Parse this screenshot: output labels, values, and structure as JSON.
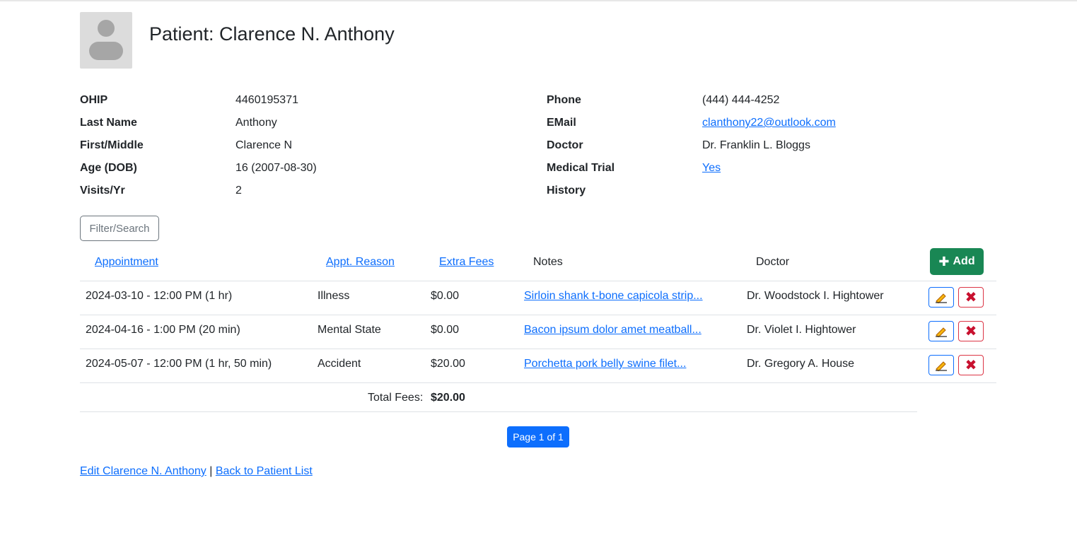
{
  "header": {
    "title": "Patient: Clarence N. Anthony"
  },
  "patient_left": [
    {
      "label": "OHIP",
      "value": "4460195371"
    },
    {
      "label": "Last Name",
      "value": "Anthony"
    },
    {
      "label": "First/Middle",
      "value": "Clarence N"
    },
    {
      "label": "Age (DOB)",
      "value": "16 (2007-08-30)"
    },
    {
      "label": "Visits/Yr",
      "value": "2"
    }
  ],
  "patient_right": [
    {
      "label": "Phone",
      "value": "(444) 444-4252"
    },
    {
      "label": "EMail",
      "value": "clanthony22@outlook.com"
    },
    {
      "label": "Doctor",
      "value": "Dr. Franklin L. Bloggs"
    },
    {
      "label": "Medical Trial",
      "value": "Yes"
    },
    {
      "label": "History",
      "value": ""
    }
  ],
  "filter": {
    "label": "Filter/Search"
  },
  "table": {
    "headers": {
      "appointment": "Appointment",
      "reason": "Appt. Reason",
      "fees": "Extra Fees",
      "notes": "Notes",
      "doctor": "Doctor"
    },
    "add_label": "Add",
    "rows": [
      {
        "appointment": "2024-03-10 - 12:00 PM (1 hr)",
        "reason": "Illness",
        "fees": "$0.00",
        "notes": "Sirloin shank t-bone capicola strip...",
        "doctor": "Dr. Woodstock I. Hightower"
      },
      {
        "appointment": "2024-04-16 - 1:00 PM (20 min)",
        "reason": "Mental State",
        "fees": "$0.00",
        "notes": "Bacon ipsum dolor amet meatball...",
        "doctor": "Dr. Violet I. Hightower"
      },
      {
        "appointment": "2024-05-07 - 12:00 PM (1 hr, 50 min)",
        "reason": "Accident",
        "fees": "$20.00",
        "notes": "Porchetta pork belly swine filet...",
        "doctor": "Dr. Gregory A. House"
      }
    ],
    "total_label": "Total Fees:",
    "total_value": "$20.00"
  },
  "pagination": {
    "label": "Page 1 of 1"
  },
  "footer": {
    "edit_link": "Edit Clarence N. Anthony",
    "separator": "|",
    "back_link": "Back to Patient List"
  },
  "colors": {
    "primary": "#0d6efd",
    "success": "#198754",
    "danger": "#dc3545"
  }
}
